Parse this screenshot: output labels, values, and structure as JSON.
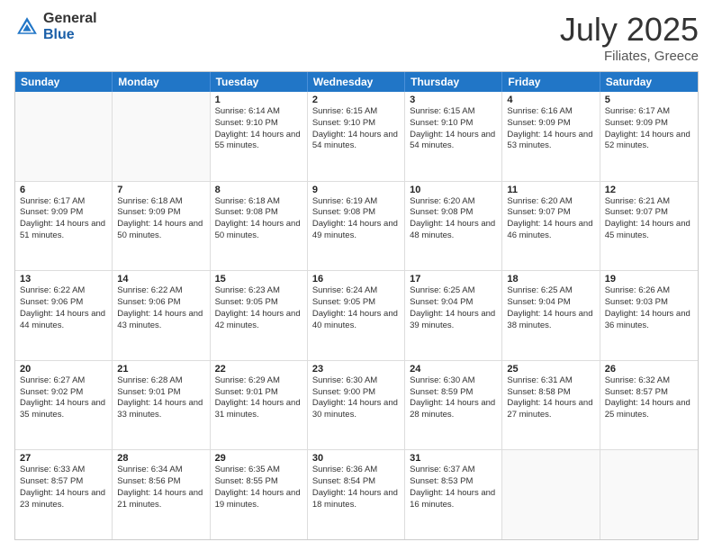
{
  "logo": {
    "general": "General",
    "blue": "Blue"
  },
  "title": {
    "month": "July 2025",
    "location": "Filiates, Greece"
  },
  "header_days": [
    "Sunday",
    "Monday",
    "Tuesday",
    "Wednesday",
    "Thursday",
    "Friday",
    "Saturday"
  ],
  "weeks": [
    [
      {
        "day": "",
        "sunrise": "",
        "sunset": "",
        "daylight": ""
      },
      {
        "day": "",
        "sunrise": "",
        "sunset": "",
        "daylight": ""
      },
      {
        "day": "1",
        "sunrise": "Sunrise: 6:14 AM",
        "sunset": "Sunset: 9:10 PM",
        "daylight": "Daylight: 14 hours and 55 minutes."
      },
      {
        "day": "2",
        "sunrise": "Sunrise: 6:15 AM",
        "sunset": "Sunset: 9:10 PM",
        "daylight": "Daylight: 14 hours and 54 minutes."
      },
      {
        "day": "3",
        "sunrise": "Sunrise: 6:15 AM",
        "sunset": "Sunset: 9:10 PM",
        "daylight": "Daylight: 14 hours and 54 minutes."
      },
      {
        "day": "4",
        "sunrise": "Sunrise: 6:16 AM",
        "sunset": "Sunset: 9:09 PM",
        "daylight": "Daylight: 14 hours and 53 minutes."
      },
      {
        "day": "5",
        "sunrise": "Sunrise: 6:17 AM",
        "sunset": "Sunset: 9:09 PM",
        "daylight": "Daylight: 14 hours and 52 minutes."
      }
    ],
    [
      {
        "day": "6",
        "sunrise": "Sunrise: 6:17 AM",
        "sunset": "Sunset: 9:09 PM",
        "daylight": "Daylight: 14 hours and 51 minutes."
      },
      {
        "day": "7",
        "sunrise": "Sunrise: 6:18 AM",
        "sunset": "Sunset: 9:09 PM",
        "daylight": "Daylight: 14 hours and 50 minutes."
      },
      {
        "day": "8",
        "sunrise": "Sunrise: 6:18 AM",
        "sunset": "Sunset: 9:08 PM",
        "daylight": "Daylight: 14 hours and 50 minutes."
      },
      {
        "day": "9",
        "sunrise": "Sunrise: 6:19 AM",
        "sunset": "Sunset: 9:08 PM",
        "daylight": "Daylight: 14 hours and 49 minutes."
      },
      {
        "day": "10",
        "sunrise": "Sunrise: 6:20 AM",
        "sunset": "Sunset: 9:08 PM",
        "daylight": "Daylight: 14 hours and 48 minutes."
      },
      {
        "day": "11",
        "sunrise": "Sunrise: 6:20 AM",
        "sunset": "Sunset: 9:07 PM",
        "daylight": "Daylight: 14 hours and 46 minutes."
      },
      {
        "day": "12",
        "sunrise": "Sunrise: 6:21 AM",
        "sunset": "Sunset: 9:07 PM",
        "daylight": "Daylight: 14 hours and 45 minutes."
      }
    ],
    [
      {
        "day": "13",
        "sunrise": "Sunrise: 6:22 AM",
        "sunset": "Sunset: 9:06 PM",
        "daylight": "Daylight: 14 hours and 44 minutes."
      },
      {
        "day": "14",
        "sunrise": "Sunrise: 6:22 AM",
        "sunset": "Sunset: 9:06 PM",
        "daylight": "Daylight: 14 hours and 43 minutes."
      },
      {
        "day": "15",
        "sunrise": "Sunrise: 6:23 AM",
        "sunset": "Sunset: 9:05 PM",
        "daylight": "Daylight: 14 hours and 42 minutes."
      },
      {
        "day": "16",
        "sunrise": "Sunrise: 6:24 AM",
        "sunset": "Sunset: 9:05 PM",
        "daylight": "Daylight: 14 hours and 40 minutes."
      },
      {
        "day": "17",
        "sunrise": "Sunrise: 6:25 AM",
        "sunset": "Sunset: 9:04 PM",
        "daylight": "Daylight: 14 hours and 39 minutes."
      },
      {
        "day": "18",
        "sunrise": "Sunrise: 6:25 AM",
        "sunset": "Sunset: 9:04 PM",
        "daylight": "Daylight: 14 hours and 38 minutes."
      },
      {
        "day": "19",
        "sunrise": "Sunrise: 6:26 AM",
        "sunset": "Sunset: 9:03 PM",
        "daylight": "Daylight: 14 hours and 36 minutes."
      }
    ],
    [
      {
        "day": "20",
        "sunrise": "Sunrise: 6:27 AM",
        "sunset": "Sunset: 9:02 PM",
        "daylight": "Daylight: 14 hours and 35 minutes."
      },
      {
        "day": "21",
        "sunrise": "Sunrise: 6:28 AM",
        "sunset": "Sunset: 9:01 PM",
        "daylight": "Daylight: 14 hours and 33 minutes."
      },
      {
        "day": "22",
        "sunrise": "Sunrise: 6:29 AM",
        "sunset": "Sunset: 9:01 PM",
        "daylight": "Daylight: 14 hours and 31 minutes."
      },
      {
        "day": "23",
        "sunrise": "Sunrise: 6:30 AM",
        "sunset": "Sunset: 9:00 PM",
        "daylight": "Daylight: 14 hours and 30 minutes."
      },
      {
        "day": "24",
        "sunrise": "Sunrise: 6:30 AM",
        "sunset": "Sunset: 8:59 PM",
        "daylight": "Daylight: 14 hours and 28 minutes."
      },
      {
        "day": "25",
        "sunrise": "Sunrise: 6:31 AM",
        "sunset": "Sunset: 8:58 PM",
        "daylight": "Daylight: 14 hours and 27 minutes."
      },
      {
        "day": "26",
        "sunrise": "Sunrise: 6:32 AM",
        "sunset": "Sunset: 8:57 PM",
        "daylight": "Daylight: 14 hours and 25 minutes."
      }
    ],
    [
      {
        "day": "27",
        "sunrise": "Sunrise: 6:33 AM",
        "sunset": "Sunset: 8:57 PM",
        "daylight": "Daylight: 14 hours and 23 minutes."
      },
      {
        "day": "28",
        "sunrise": "Sunrise: 6:34 AM",
        "sunset": "Sunset: 8:56 PM",
        "daylight": "Daylight: 14 hours and 21 minutes."
      },
      {
        "day": "29",
        "sunrise": "Sunrise: 6:35 AM",
        "sunset": "Sunset: 8:55 PM",
        "daylight": "Daylight: 14 hours and 19 minutes."
      },
      {
        "day": "30",
        "sunrise": "Sunrise: 6:36 AM",
        "sunset": "Sunset: 8:54 PM",
        "daylight": "Daylight: 14 hours and 18 minutes."
      },
      {
        "day": "31",
        "sunrise": "Sunrise: 6:37 AM",
        "sunset": "Sunset: 8:53 PM",
        "daylight": "Daylight: 14 hours and 16 minutes."
      },
      {
        "day": "",
        "sunrise": "",
        "sunset": "",
        "daylight": ""
      },
      {
        "day": "",
        "sunrise": "",
        "sunset": "",
        "daylight": ""
      }
    ]
  ]
}
